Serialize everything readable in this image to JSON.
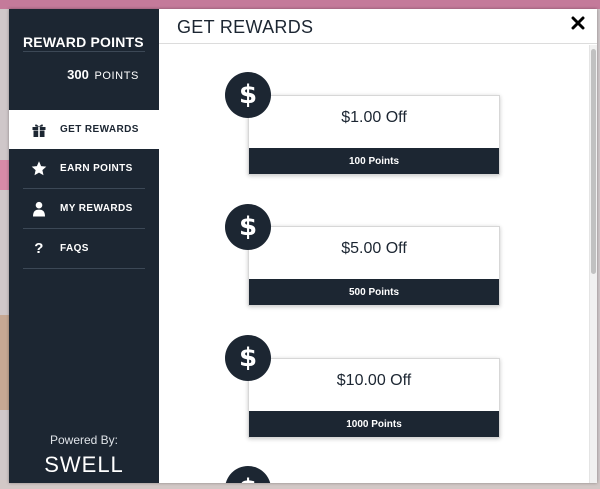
{
  "sidebar": {
    "title": "REWARD POINTS",
    "points_value": "300",
    "points_unit": "POINTS",
    "items": [
      {
        "label": "GET REWARDS",
        "icon": "gift-icon",
        "active": true
      },
      {
        "label": "EARN POINTS",
        "icon": "star-icon",
        "active": false
      },
      {
        "label": "MY REWARDS",
        "icon": "user-icon",
        "active": false
      },
      {
        "label": "FAQS",
        "icon": "question-icon",
        "active": false
      }
    ],
    "powered_by": "Powered By:",
    "brand": "SWELL"
  },
  "main": {
    "title": "GET REWARDS",
    "close_icon": "close-icon",
    "rewards": [
      {
        "amount": "$1.00 Off",
        "cost": "100 Points",
        "icon": "dollar-icon"
      },
      {
        "amount": "$5.00 Off",
        "cost": "500 Points",
        "icon": "dollar-icon"
      },
      {
        "amount": "$10.00 Off",
        "cost": "1000 Points",
        "icon": "dollar-icon"
      }
    ],
    "next_badge_symbol": "$"
  },
  "colors": {
    "navy": "#1c2632",
    "white": "#ffffff",
    "overlay": "#b3a8ab"
  }
}
